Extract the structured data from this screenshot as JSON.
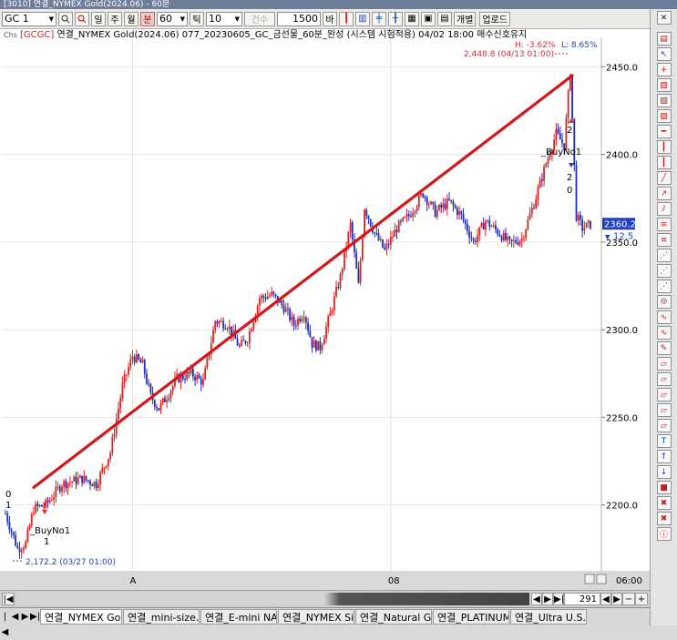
{
  "window": {
    "title": "[3010] 연결_NYMEX Gold(2024.06) - 60분"
  },
  "toolbar": {
    "symbol": "GC 1",
    "period_labels": [
      "일",
      "주",
      "월",
      "분"
    ],
    "active_period": "분",
    "interval_value": "60",
    "tick_label": "틱",
    "tick_value": "10",
    "disabled_label": "건수",
    "count_value": "1500",
    "count_unit": "바",
    "individual_label": "개별",
    "upload_label": "업로드"
  },
  "info_line": {
    "prefix": "Chs",
    "code": "[GCGC]",
    "text": "연결_NYMEX Gold(2024.06) 077_20230605_GC_금선물_60분_완성 (시스템 시험적용) 04/02 18:00 매수신호유지"
  },
  "annotations": {
    "hl_label": "H: -3.62%",
    "low_label": "L: 8.65%",
    "high_point": "2,448.8 (04/13 01:00)",
    "low_point": "2,172.2 (03/27 01:00)",
    "buy_left": "_BuyNo1",
    "buy_left_num": "1",
    "buy_right": "_BuyNo1",
    "left_zero": "0",
    "left_one": "1",
    "right_nums": [
      "2",
      "2",
      "0"
    ]
  },
  "price_axis": {
    "ticks": [
      "2450.0",
      "2400.0",
      "2350.0",
      "2300.0",
      "2250.0",
      "2200.0"
    ],
    "current_price": "2360.2",
    "change": "12.5"
  },
  "time_axis": {
    "labels": [
      "A",
      "08"
    ],
    "clock": "06:00"
  },
  "scrollbar": {
    "bar_count": "291"
  },
  "tabs": [
    "연결_NYMEX Gol...",
    "연결_mini-size...",
    "연결_E-mini NA...",
    "연결_NYMEX Sil...",
    "연결_Natural G...",
    "연결_PLATINUM ...",
    "연결_Ultra U.S..."
  ],
  "colors": {
    "up": "#e02020",
    "down": "#1f2fb0",
    "trend": "#d21818",
    "price_box": "#1f3fc0"
  },
  "chart_data": {
    "type": "candlestick",
    "ylim": [
      2165,
      2458
    ],
    "trendline": {
      "from": {
        "index": 14,
        "price": 2210
      },
      "to": {
        "index": 281,
        "price": 2445
      }
    },
    "anchors": [
      [
        0,
        2195
      ],
      [
        3,
        2185
      ],
      [
        6,
        2175
      ],
      [
        10,
        2178
      ],
      [
        14,
        2198
      ],
      [
        20,
        2200
      ],
      [
        28,
        2212
      ],
      [
        38,
        2215
      ],
      [
        45,
        2212
      ],
      [
        52,
        2230
      ],
      [
        58,
        2268
      ],
      [
        63,
        2285
      ],
      [
        68,
        2280
      ],
      [
        72,
        2262
      ],
      [
        76,
        2255
      ],
      [
        80,
        2262
      ],
      [
        85,
        2272
      ],
      [
        92,
        2275
      ],
      [
        98,
        2270
      ],
      [
        104,
        2305
      ],
      [
        110,
        2303
      ],
      [
        116,
        2290
      ],
      [
        120,
        2295
      ],
      [
        126,
        2318
      ],
      [
        132,
        2320
      ],
      [
        138,
        2313
      ],
      [
        143,
        2303
      ],
      [
        148,
        2310
      ],
      [
        152,
        2292
      ],
      [
        156,
        2290
      ],
      [
        160,
        2305
      ],
      [
        166,
        2330
      ],
      [
        171,
        2360
      ],
      [
        175,
        2325
      ],
      [
        178,
        2370
      ],
      [
        183,
        2355
      ],
      [
        188,
        2345
      ],
      [
        194,
        2358
      ],
      [
        200,
        2365
      ],
      [
        207,
        2378
      ],
      [
        213,
        2367
      ],
      [
        220,
        2373
      ],
      [
        226,
        2365
      ],
      [
        232,
        2350
      ],
      [
        238,
        2362
      ],
      [
        244,
        2356
      ],
      [
        250,
        2349
      ],
      [
        256,
        2352
      ],
      [
        262,
        2372
      ],
      [
        268,
        2395
      ],
      [
        273,
        2412
      ],
      [
        277,
        2405
      ],
      [
        280,
        2448
      ],
      [
        283,
        2365
      ],
      [
        286,
        2358
      ],
      [
        290,
        2360
      ]
    ]
  }
}
